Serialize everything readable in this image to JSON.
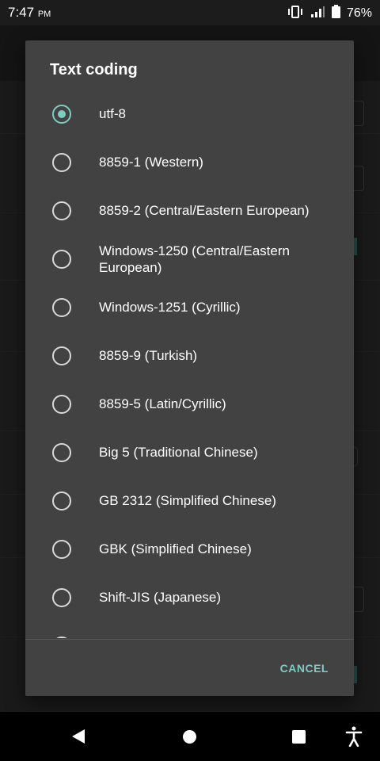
{
  "status_bar": {
    "time": "7:47",
    "ampm": "PM",
    "battery": "76%",
    "icons": [
      "vibrate-icon",
      "signal-icon",
      "battery-icon"
    ]
  },
  "dialog": {
    "title": "Text coding",
    "options": [
      {
        "label": "utf-8",
        "selected": true
      },
      {
        "label": "8859-1 (Western)",
        "selected": false
      },
      {
        "label": "8859-2 (Central/Eastern European)",
        "selected": false
      },
      {
        "label": "Windows-1250 (Central/Eastern European)",
        "selected": false
      },
      {
        "label": "Windows-1251 (Cyrillic)",
        "selected": false
      },
      {
        "label": "8859-9 (Turkish)",
        "selected": false
      },
      {
        "label": "8859-5 (Latin/Cyrillic)",
        "selected": false
      },
      {
        "label": "Big 5 (Traditional Chinese)",
        "selected": false
      },
      {
        "label": "GB 2312 (Simplified Chinese)",
        "selected": false
      },
      {
        "label": "GBK (Simplified Chinese)",
        "selected": false
      },
      {
        "label": "Shift-JIS (Japanese)",
        "selected": false
      }
    ],
    "cancel_label": "CANCEL"
  },
  "nav_bar": {
    "icons": [
      "back-icon",
      "home-icon",
      "recents-icon",
      "accessibility-icon"
    ]
  },
  "colors": {
    "accent": "#7fcbc4",
    "dialog_bg": "#424242",
    "background": "#303030"
  }
}
